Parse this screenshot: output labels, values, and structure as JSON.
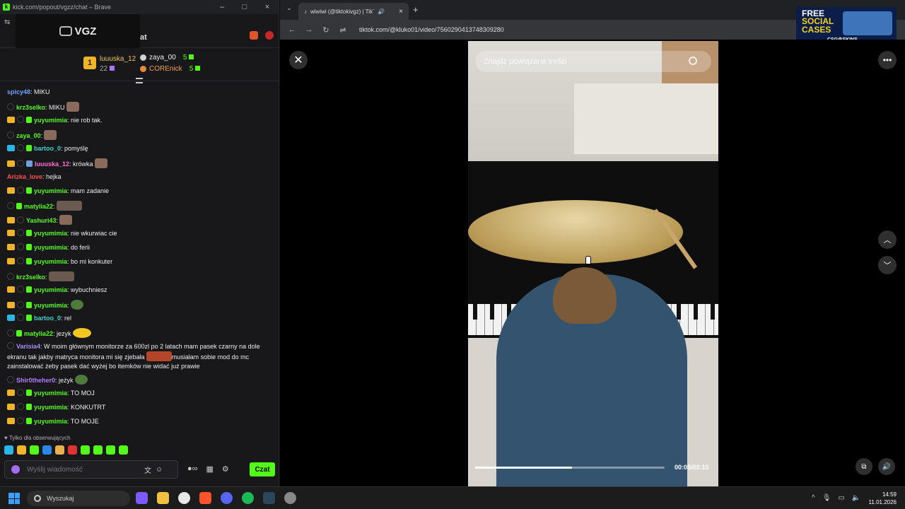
{
  "left_window": {
    "title": "kick.com/popout/vgzz/chat – Brave",
    "channel_logo": "VGZ",
    "chat_label": "at",
    "leaderboard": {
      "first": {
        "rank": "1",
        "name": "luuuska_12",
        "score": "22"
      },
      "rows": [
        {
          "name": "zaya_00",
          "count": "5"
        },
        {
          "name": "COREnick",
          "count": "5"
        }
      ]
    },
    "messages": [
      {
        "user": "spicy48",
        "color": "#6ea0ff",
        "text": ": MIKU",
        "badges": [],
        "emote": ""
      },
      {
        "user": "krz3selko",
        "color": "#53fc18",
        "text": ": MIKU",
        "badges": [
          "ring"
        ],
        "emote": "em"
      },
      {
        "user": "yuyumimia",
        "color": "#53fc18",
        "text": ": nie rob tak.",
        "badges": [
          "crown",
          "ring",
          "sub"
        ],
        "emote": ""
      },
      {
        "user": "zaya_00",
        "color": "#53fc18",
        "text": ":",
        "badges": [
          "ring"
        ],
        "emote": "em"
      },
      {
        "user": "bartoo_0",
        "color": "#3bd1c9",
        "text": ": pomyślę",
        "badges": [
          "mod",
          "ring",
          "sub"
        ],
        "emote": ""
      },
      {
        "user": "luuuska_12",
        "color": "#ff6ad5",
        "text": ": krówka",
        "badges": [
          "crown",
          "ring",
          "gift"
        ],
        "emote": "em"
      },
      {
        "user": "Arizka_love",
        "color": "#ff4d4d",
        "text": ": hejka",
        "badges": [],
        "emote": ""
      },
      {
        "user": "yuyumimia",
        "color": "#53fc18",
        "text": ": mam zadanie",
        "badges": [
          "crown",
          "ring",
          "sub"
        ],
        "emote": ""
      },
      {
        "user": "matylia22",
        "color": "#53fc18",
        "text": ":",
        "badges": [
          "ring",
          "sub"
        ],
        "emote": "w"
      },
      {
        "user": "Yashuri43",
        "color": "#53fc18",
        "text": ":",
        "badges": [
          "crown",
          "ring"
        ],
        "emote": "em"
      },
      {
        "user": "yuyumimia",
        "color": "#53fc18",
        "text": ": nie wkurwiac cie",
        "badges": [
          "crown",
          "ring",
          "sub"
        ],
        "emote": ""
      },
      {
        "user": "yuyumimia",
        "color": "#53fc18",
        "text": ": do ferii",
        "badges": [
          "crown",
          "ring",
          "sub"
        ],
        "emote": ""
      },
      {
        "user": "yuyumimia",
        "color": "#53fc18",
        "text": ": bo mi konkuter",
        "badges": [
          "crown",
          "ring",
          "sub"
        ],
        "emote": ""
      },
      {
        "user": "krz3selko",
        "color": "#53fc18",
        "text": ":",
        "badges": [
          "ring"
        ],
        "emote": "w"
      },
      {
        "user": "yuyumimia",
        "color": "#53fc18",
        "text": ": wybuchniesz",
        "badges": [
          "crown",
          "ring",
          "sub"
        ],
        "emote": ""
      },
      {
        "user": "yuyumimia",
        "color": "#53fc18",
        "text": ":",
        "badges": [
          "crown",
          "ring",
          "sub"
        ],
        "emote": "g"
      },
      {
        "user": "bartoo_0",
        "color": "#3bd1c9",
        "text": ": rel",
        "badges": [
          "mod",
          "ring",
          "sub"
        ],
        "emote": ""
      },
      {
        "user": "matylia22",
        "color": "#53fc18",
        "text": ": jezyk",
        "badges": [
          "ring",
          "sub"
        ],
        "emote": "y"
      }
    ],
    "long_message": {
      "user": "Varisia4",
      "color": "#a98bff",
      "text_a": ": W moim głównym monitorze za 600zl po 2 latach mam pasek czarny na dole ekranu tak jakby matryca monitora mi się zjebała",
      "text_b": "musiałam sobie mod do mc zainstalować żeby pasek dać wyżej bo itemków nie widać już prawie"
    },
    "messages2": [
      {
        "user": "Shir0theher0",
        "color": "#b57dff",
        "text": ": jeżyk",
        "badges": [
          "ring"
        ],
        "emote": "g"
      },
      {
        "user": "yuyumimia",
        "color": "#53fc18",
        "text": ": TO MOJ",
        "badges": [
          "crown",
          "ring",
          "sub"
        ],
        "emote": ""
      },
      {
        "user": "yuyumimia",
        "color": "#53fc18",
        "text": ": KONKUTRT",
        "badges": [
          "crown",
          "ring",
          "sub"
        ],
        "emote": ""
      },
      {
        "user": "yuyumimia",
        "color": "#53fc18",
        "text": ": TO MOJE",
        "badges": [
          "crown",
          "ring",
          "sub"
        ],
        "emote": ""
      }
    ],
    "followers_only": "♥ Tylko dla obserwujących",
    "input_placeholder": "Wyślij wiadomość",
    "send_label": "Czat"
  },
  "right_window": {
    "tab_title": "wiwiwi (@tiktokivgz) | TikTok",
    "url": "tiktok.com/@kluko01/video/7560290413748309280",
    "search_placeholder": "Znajdź powiązane treści",
    "time": "00:05/00:10",
    "progress": 0.51,
    "ad": {
      "line1": "FREE",
      "line2": "SOCIAL",
      "line3": "CASES",
      "brand": "CSG⚙SKINS"
    }
  },
  "taskbar": {
    "search_label": "Wyszukaj",
    "time": "14:59",
    "date": "11.01.2026"
  },
  "colors": {
    "kick_green": "#53fc18",
    "chat_bg": "#18181b"
  }
}
